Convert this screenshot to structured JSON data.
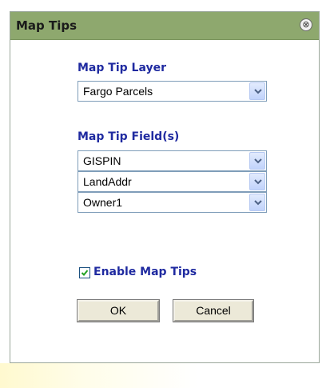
{
  "dialog": {
    "title": "Map Tips",
    "close_symbol": "⊗",
    "layer_label": "Map Tip Layer",
    "layer_value": "Fargo Parcels",
    "fields_label": "Map Tip Field(s)",
    "fields": [
      "GISPIN",
      "LandAddr",
      "Owner1"
    ],
    "enable_label": "Enable Map Tips",
    "enable_checked": true,
    "ok_label": "OK",
    "cancel_label": "Cancel"
  },
  "colors": {
    "titlebar": "#8ea86e",
    "label_text": "#1f2aa0",
    "button_face": "#ece9d8"
  }
}
